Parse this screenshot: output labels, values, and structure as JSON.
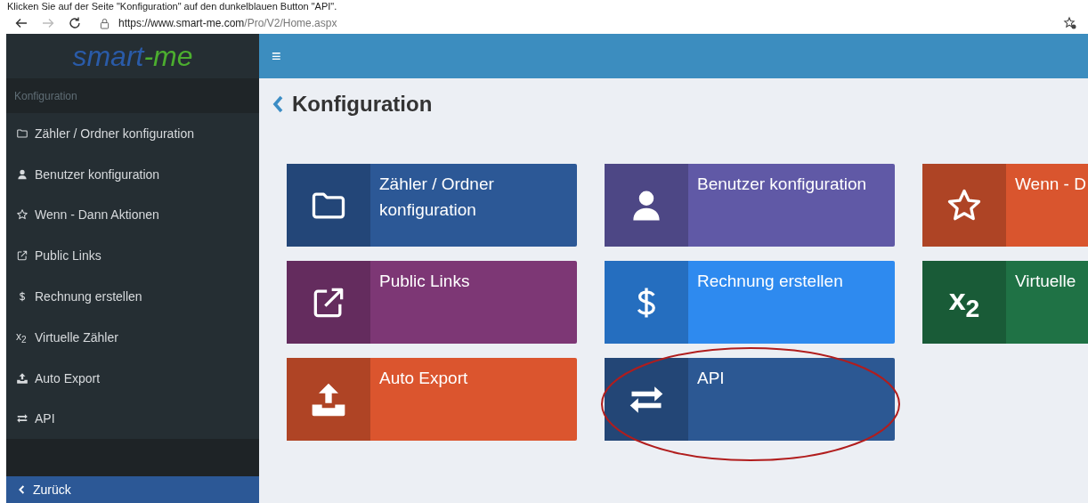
{
  "caption": "Klicken Sie auf der Seite \"Konfiguration\" auf den dunkelblauen Button \"API\".",
  "browser": {
    "url_host": "https://www.smart-me.com",
    "url_path": "/Pro/V2/Home.aspx"
  },
  "logo": {
    "first": "smart",
    "second": "-me"
  },
  "sidebar": {
    "section": "Konfiguration",
    "items": [
      {
        "kind": "folder",
        "label": "Zähler / Ordner konfiguration"
      },
      {
        "kind": "user",
        "label": "Benutzer konfiguration"
      },
      {
        "kind": "star",
        "label": "Wenn - Dann Aktionen"
      },
      {
        "kind": "link",
        "label": "Public Links"
      },
      {
        "kind": "dollar",
        "label": "Rechnung erstellen"
      },
      {
        "kind": "subscript",
        "label": "Virtuelle Zähler",
        "glyph": "x$_{2}$"
      },
      {
        "kind": "upload",
        "label": "Auto Export"
      },
      {
        "kind": "exchange",
        "label": "API"
      }
    ],
    "back": "Zurück"
  },
  "topbar": {
    "menu": "≡"
  },
  "page_title": "Konfiguration",
  "tiles": [
    {
      "kind": "folder",
      "label": "Zähler / Ordner konfiguration",
      "color": "#2c5896",
      "highlight": false
    },
    {
      "kind": "user",
      "label": "Benutzer konfiguration",
      "color": "#6059a6",
      "highlight": false
    },
    {
      "kind": "star",
      "label": "Wenn - D",
      "color": "#d9552e",
      "highlight": false
    },
    {
      "kind": "link",
      "label": "Public Links",
      "color": "#7d3775",
      "highlight": false
    },
    {
      "kind": "dollar",
      "label": "Rechnung erstellen",
      "color": "#2e8aef",
      "highlight": false
    },
    {
      "kind": "subscript",
      "label": "Virtuelle",
      "color": "#1f7245",
      "highlight": false,
      "glyph": "x$_{2}$"
    },
    {
      "kind": "upload",
      "label": "Auto Export",
      "color": "#db552e",
      "highlight": false
    },
    {
      "kind": "exchange",
      "label": "API",
      "color": "#2c5893",
      "highlight": true
    }
  ]
}
